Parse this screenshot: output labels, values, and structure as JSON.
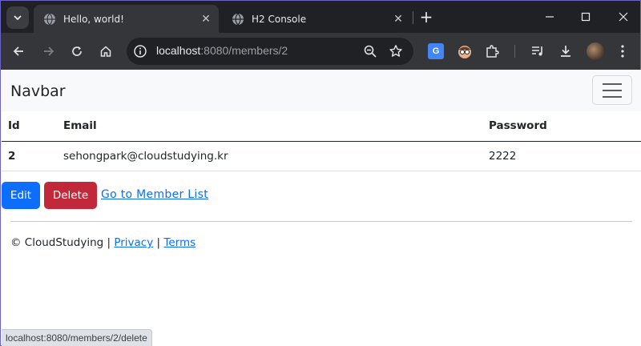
{
  "browser": {
    "tabs": [
      {
        "title": "Hello, world!",
        "active": true
      },
      {
        "title": "H2 Console",
        "active": false
      }
    ],
    "url_host": "localhost",
    "url_rest": ":8080/members/2",
    "extension_label": "G",
    "status_url": "localhost:8080/members/2/delete"
  },
  "navbar": {
    "brand": "Navbar"
  },
  "table": {
    "headers": [
      "Id",
      "Email",
      "Password"
    ],
    "rows": [
      [
        "2",
        "sehongpark@cloudstudying.kr",
        "2222"
      ]
    ]
  },
  "actions": {
    "edit_label": "Edit",
    "delete_label": "Delete",
    "list_link": "Go to Member List"
  },
  "footer": {
    "copyright": "© CloudStudying |",
    "privacy": "Privacy",
    "separator": "|",
    "terms": "Terms"
  },
  "colors": {
    "primary": "#0d6efd",
    "danger": "#c1283a",
    "chrome_dark": "#202124",
    "chrome_toolbar": "#35363a"
  },
  "icons": [
    "tab-search-icon",
    "globe-icon",
    "close-icon",
    "plus-icon",
    "minimize-icon",
    "maximize-icon",
    "back-icon",
    "forward-icon",
    "reload-icon",
    "home-icon",
    "site-info-icon",
    "zoom-icon",
    "star-icon",
    "translate-icon",
    "extension-puzzle-icon",
    "media-icon",
    "download-icon",
    "avatar",
    "kebab-menu-icon",
    "hamburger-icon"
  ]
}
